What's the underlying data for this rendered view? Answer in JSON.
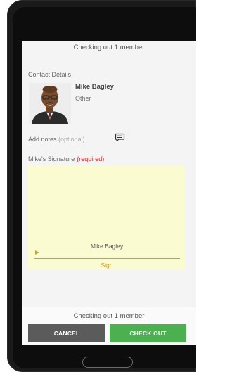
{
  "header": {
    "text": "Checking out  1 member"
  },
  "contact": {
    "section_label": "Contact Details",
    "name": "Mike Bagley",
    "type": "Other"
  },
  "notes": {
    "label": "Add notes",
    "optional": "(optional)"
  },
  "signature": {
    "label": "Mike's Signature",
    "required": "(required)",
    "signer_name": "Mike Bagley",
    "sign_text": "Sign"
  },
  "footer": {
    "text": "Checking out  1 member",
    "cancel_label": "CANCEL",
    "checkout_label": "CHECK OUT"
  },
  "colors": {
    "checkout_button": "#4caf50",
    "cancel_button": "#5b5b5b",
    "required_text": "#c62828",
    "signature_pad": "#fbfbd2"
  }
}
